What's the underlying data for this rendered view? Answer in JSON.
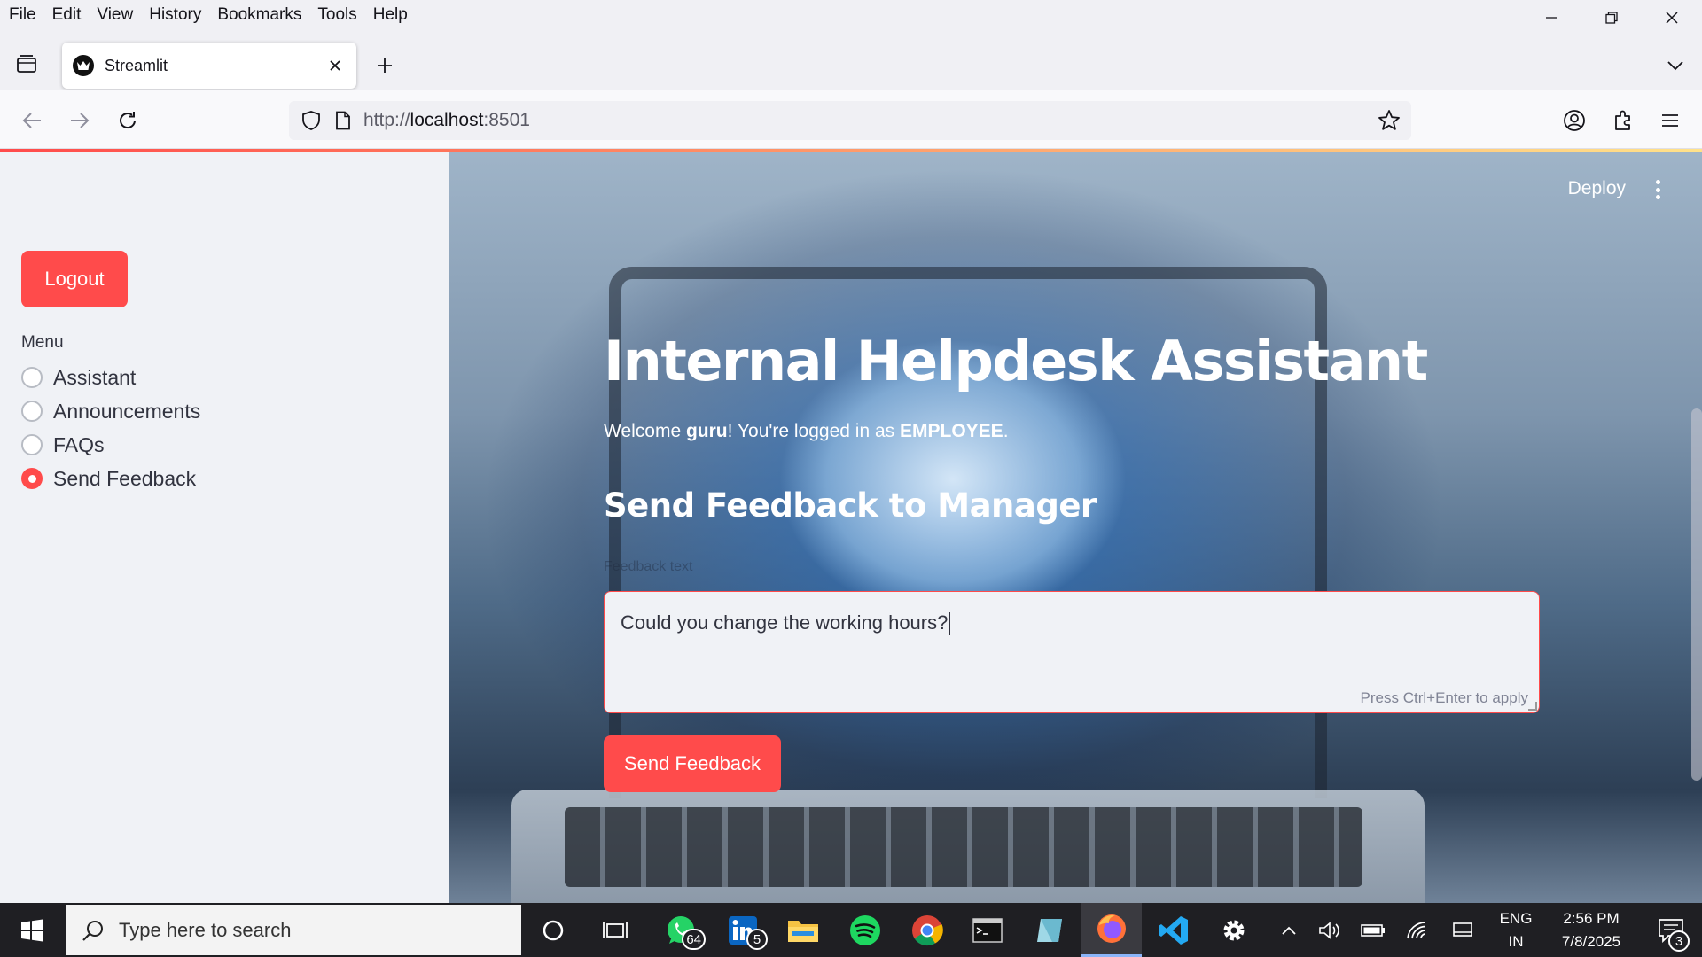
{
  "browser": {
    "menu": [
      {
        "label": "File"
      },
      {
        "label": "Edit"
      },
      {
        "label": "View"
      },
      {
        "label": "History"
      },
      {
        "label": "Bookmarks"
      },
      {
        "label": "Tools"
      },
      {
        "label": "Help"
      }
    ],
    "tab": {
      "title": "Streamlit"
    },
    "url": {
      "scheme": "http://",
      "host": "localhost",
      "port": ":8501"
    }
  },
  "sidebar": {
    "logout_label": "Logout",
    "menu_label": "Menu",
    "options": [
      {
        "label": "Assistant",
        "selected": false
      },
      {
        "label": "Announcements",
        "selected": false
      },
      {
        "label": "FAQs",
        "selected": false
      },
      {
        "label": "Send Feedback",
        "selected": true
      }
    ]
  },
  "main": {
    "deploy_label": "Deploy",
    "title": "Internal Helpdesk Assistant",
    "welcome": {
      "prefix": "Welcome ",
      "user": "guru",
      "middle": "! You're logged in as ",
      "role": "EMPLOYEE",
      "suffix": "."
    },
    "section_title": "Send Feedback to Manager",
    "feedback_label": "Feedback text",
    "feedback_value": "Could you change the working hours?",
    "feedback_hint": "Press Ctrl+Enter to apply",
    "send_label": "Send Feedback"
  },
  "taskbar": {
    "search_placeholder": "Type here to search",
    "whatsapp_badge": "64",
    "linkedin_badge": "5",
    "language": "ENG",
    "region": "IN",
    "time": "2:56 PM",
    "date": "7/8/2025",
    "notifications": "3"
  },
  "colors": {
    "accent": "#ff4b4b",
    "sidebar_bg": "#f0f2f6",
    "taskbar_bg": "#1f1f23"
  }
}
